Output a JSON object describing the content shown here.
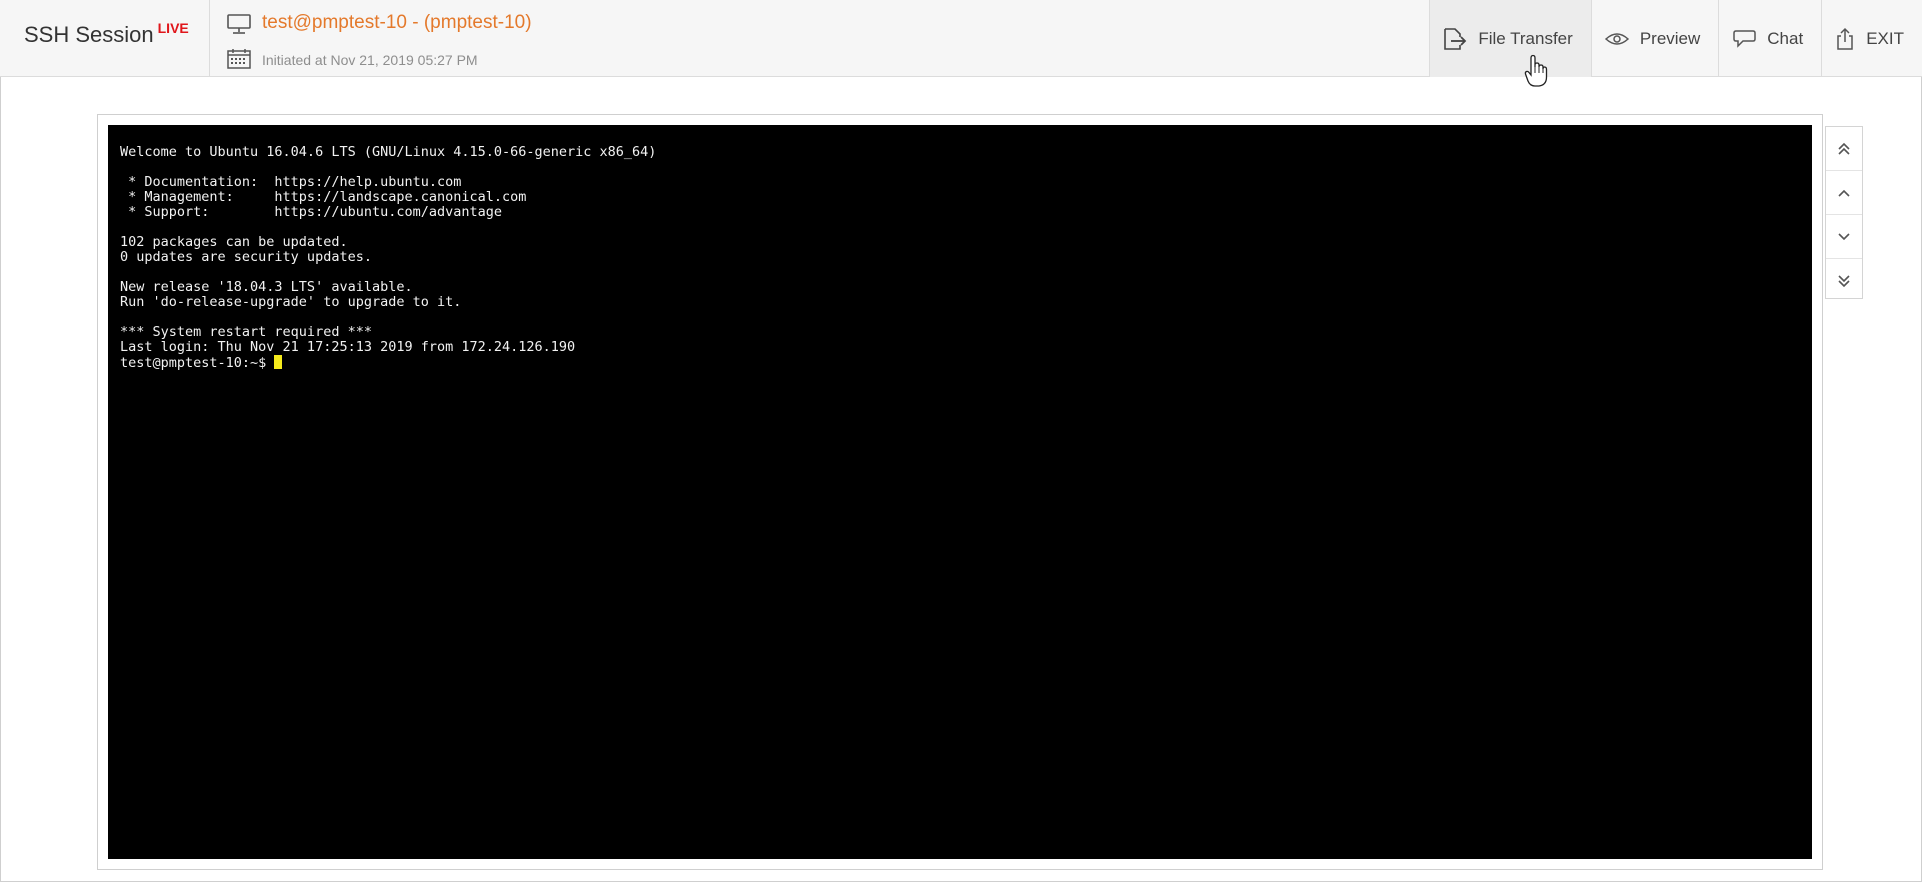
{
  "app": {
    "title": "SSH Session",
    "live_badge": "LIVE"
  },
  "session": {
    "title": "test@pmptest-10 - (pmptest-10)",
    "initiated": "Initiated at Nov 21, 2019 05:27 PM",
    "title_icon": "monitor-icon",
    "date_icon": "calendar-icon"
  },
  "actions": [
    {
      "label": "File Transfer",
      "icon": "file-transfer-icon"
    },
    {
      "label": "Preview",
      "icon": "eye-icon"
    },
    {
      "label": "Chat",
      "icon": "chat-icon"
    },
    {
      "label": "EXIT",
      "icon": "exit-icon"
    }
  ],
  "terminal": {
    "lines": [
      "Welcome to Ubuntu 16.04.6 LTS (GNU/Linux 4.15.0-66-generic x86_64)",
      "",
      " * Documentation:  https://help.ubuntu.com",
      " * Management:     https://landscape.canonical.com",
      " * Support:        https://ubuntu.com/advantage",
      "",
      "102 packages can be updated.",
      "0 updates are security updates.",
      "",
      "New release '18.04.3 LTS' available.",
      "Run 'do-release-upgrade' to upgrade to it.",
      "",
      "*** System restart required ***",
      "Last login: Thu Nov 21 17:25:13 2019 from 172.24.126.190"
    ],
    "prompt": "test@pmptest-10:~$ "
  },
  "colors": {
    "accent": "#e4792b",
    "live": "#e0161b",
    "cursor": "#f5ea1c",
    "terminal_bg": "#000000",
    "terminal_fg": "#f2f2f2"
  }
}
